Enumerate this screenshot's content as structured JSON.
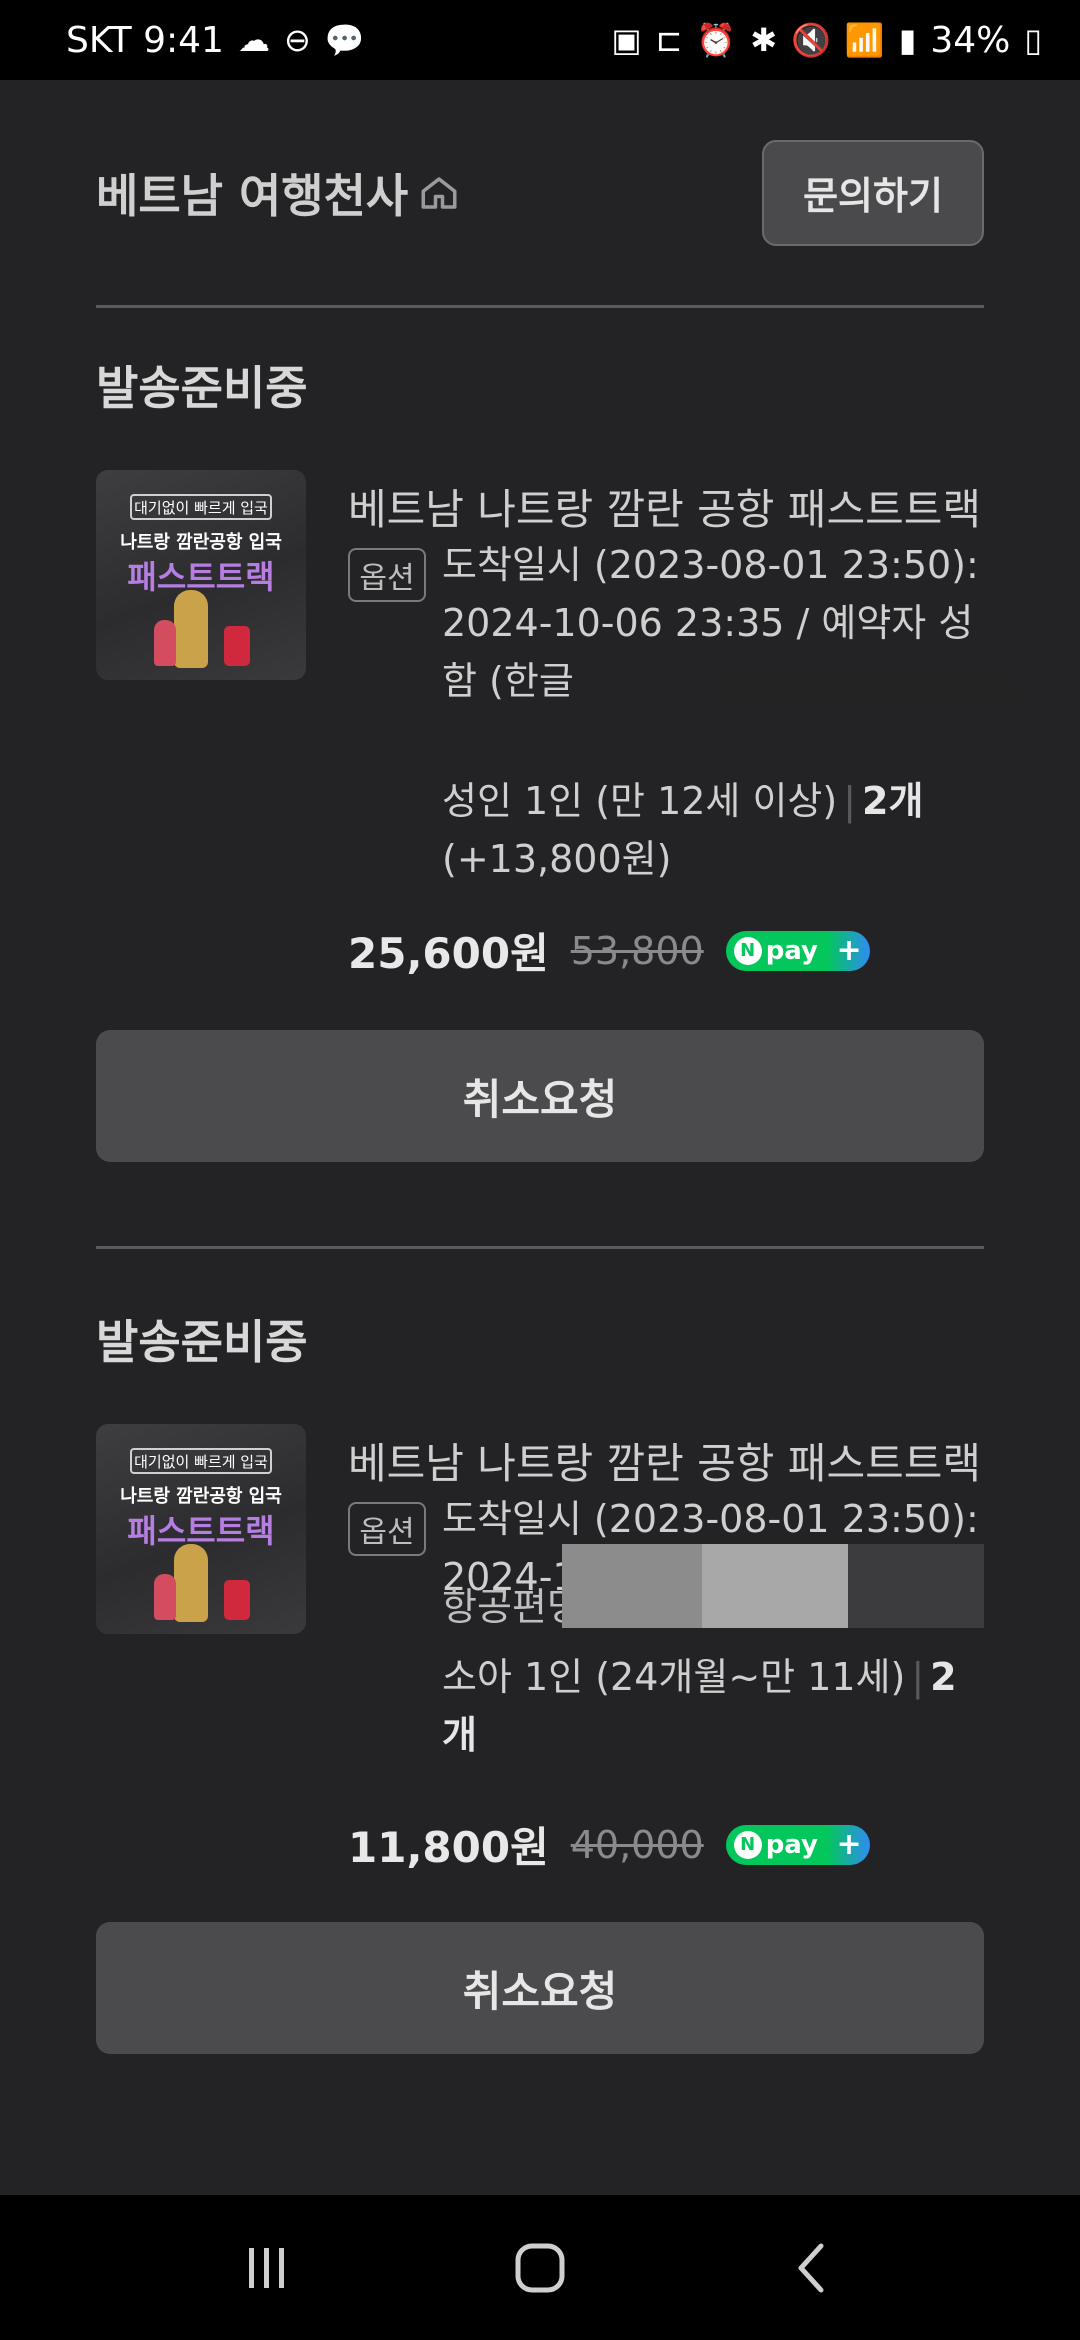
{
  "status_bar": {
    "carrier_time": "SKT 9:41",
    "battery": "34%",
    "left_icons": [
      "cloud-sync-icon",
      "do-not-disturb-icon",
      "messenger-icon"
    ],
    "right_icons": [
      "app-notification-icon",
      "sleep-icon",
      "alarm-icon",
      "bluetooth-icon",
      "mute-icon",
      "wifi-icon",
      "signal-icon",
      "battery-icon"
    ]
  },
  "header": {
    "store_name": "베트남 여행천사",
    "inquiry_label": "문의하기"
  },
  "orders": [
    {
      "status": "발송준비중",
      "thumbnail": {
        "tag": "대기없이 빠르게 입국",
        "line2": "나트랑 깜란공항 입국",
        "line3": "패스트트랙"
      },
      "title": "베트남 나트랑 깜란 공항 패스트트랙",
      "option_badge": "옵션",
      "option_text": "도착일시 (2023-08-01 23:50): 2024-10-06 23:35 / 예약자 성함 (한글",
      "quantity_desc": "성인 1인 (만 12세 이상)",
      "quantity": "2개",
      "extra": "(+13,800원)",
      "price": "25,600원",
      "original_price": "53,800",
      "pay_badge": "pay",
      "cancel_label": "취소요청"
    },
    {
      "status": "발송준비중",
      "thumbnail": {
        "tag": "대기없이 빠르게 입국",
        "line2": "나트랑 깜란공항 입국",
        "line3": "패스트트랙"
      },
      "title": "베트남 나트랑 깜란 공항 패스트트랙",
      "option_badge": "옵션",
      "option_text": "도착일시 (2023-08-01 23:50): 2024-10-06 23:35 / 예약자 성",
      "partial_text": "항공편명:",
      "quantity_desc": "소아 1인 (24개월~만 11세)",
      "quantity": "2개",
      "price": "11,800원",
      "original_price": "40,000",
      "pay_badge": "pay",
      "cancel_label": "취소요청"
    }
  ],
  "nav_bar": {
    "icons": [
      "recent-apps-icon",
      "home-icon",
      "back-icon"
    ]
  }
}
